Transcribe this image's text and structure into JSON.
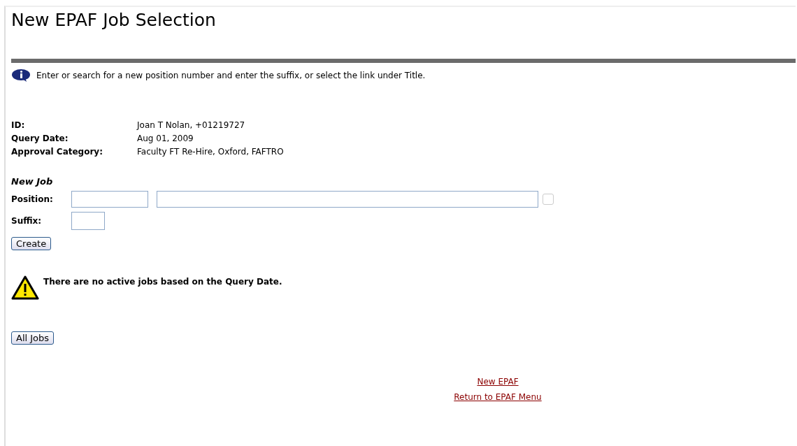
{
  "title": "New EPAF Job Selection",
  "info": "Enter or search for a new position number and enter the suffix, or select the link under Title.",
  "details": [
    {
      "label": "ID:",
      "value": "Joan T Nolan, +01219727"
    },
    {
      "label": "Query Date:",
      "value": "Aug 01, 2009"
    },
    {
      "label": "Approval Category:",
      "value": "Faculty FT Re-Hire, Oxford, FAFTRO"
    }
  ],
  "new_job": {
    "heading": "New Job",
    "position_label": "Position:",
    "suffix_label": "Suffix:",
    "create_button": "Create"
  },
  "warning": "There are no active jobs based on the Query Date.",
  "all_jobs_button": "All Jobs",
  "links": [
    "New EPAF",
    "Return to EPAF Menu"
  ]
}
